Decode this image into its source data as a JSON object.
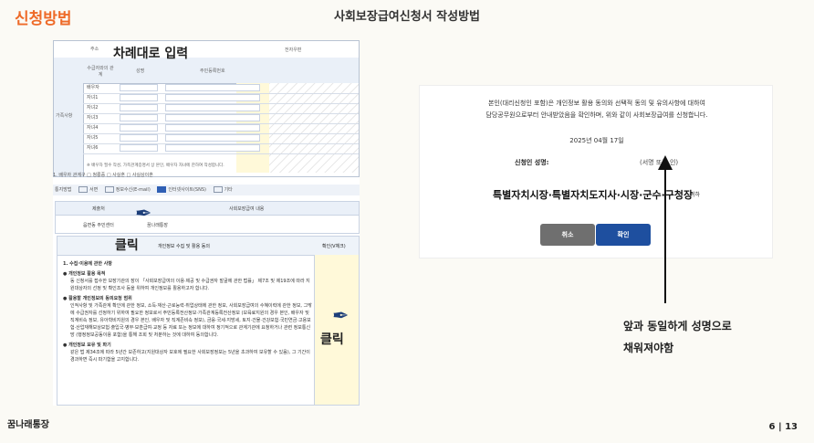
{
  "header": {
    "section_label": "신청방법",
    "page_title": "사회보장급여신청서 작성방법"
  },
  "footer": {
    "brand": "꿈나래통장",
    "page_number": "6 | 13"
  },
  "form_image": {
    "address_label": "주소",
    "phone_label": "전자우편",
    "annotation_order": "차례대로 입력",
    "annotation_click_1": "클릭",
    "annotation_click_2": "클릭",
    "family_section_label": "가족사항",
    "column_headers": [
      "수급자와의 관계",
      "성명",
      "주민등록번호"
    ],
    "family_rows": [
      "배우자",
      "자녀1",
      "자녀2",
      "자녀3",
      "자녀4",
      "자녀5",
      "자녀6"
    ],
    "family_note": "※ 배우자 필수 작성, 가족관계증명서 상 본인, 배우자 자녀에 한하여 작성합니다.",
    "disability_line": "1. 배우자 관계구 □ 청룡증  □ 사실혼  □ 사실상이혼",
    "receive_method_label": "통지방법",
    "receive_options": [
      {
        "label": "서면",
        "checked": false
      },
      {
        "label": "정보수신(E-mail)",
        "checked": false
      },
      {
        "label": "인터넷사이트(SNS)",
        "checked": true
      },
      {
        "label": "기타",
        "checked": false
      }
    ],
    "service_table": {
      "headers": [
        "제출처",
        "사회보장급여 내용"
      ],
      "row": [
        "읍면동 주민센터",
        "꿈나래통장"
      ]
    },
    "consent": {
      "header": "개인정보 수집 및 활용 동의",
      "confirm_column": "확인(V체크)",
      "section_title": "1. 수집·이용에 관한 사항",
      "items": [
        {
          "title": "● 개인정보 활용 목적",
          "text": "동 신청서를 접수한 보장기관의 장이 「사회보장급여의 이용·제공 및 수급권자 발굴에 관한 법률」 제7조 및 제19조에 따라 지원대상자의 선정 및 확인조사 등을 위하여 개인정보를 활용하고자 합니다."
        },
        {
          "title": "● 활용할 개인정보의 동의요청 범위",
          "text": "인적사항 및 가족관계 확인에 관한 정보, 소득·재산·근로능력·취업상태에 관한 정보, 사회보장급여의 수혜이력에 관한 정보, 그밖에 수급권자를 선정하기 위하여 필요한 정보로서 주민등록전산정보·가족관계등록전산정보 (보육료지원의 경우 본인, 배우자 및 직계비속 정보, 유아학비지원의 경우 본인, 배우자 및 직계존비속 정보), 금융·국세·지방세, 토지·건물·건강보험·국민연금·고용보험·산업재해보상보험·출입국·병무·보훈급여·교정 등 자료 또는 정보에 대하여 정기적으로 관계기관에 요청하거나 관련 정보통신망 (행정정보공동이용 포함)을 통해 조회 및 처분하는 것에 대하여 동의합니다."
        },
        {
          "title": "● 개인정보 보유 및 파기",
          "text": "같은 법 제34조에 따라 5년간 보존하고(지원대상자 보호에 필요한 사회보장정보는 5년을 초과하여 보유할 수 있음), 그 기간이 경과하면 즉시 파기함을 고지합니다."
        }
      ]
    }
  },
  "dialog": {
    "line1": "본인(대리신청인 포함)은 개인정보 활용 동의와 선택적 동의 및 유의사항에 대하여",
    "line2": "담당공무원으로부터 안내받았음을 확인하며, 위와 같이 사회보장급여를 신청합니다.",
    "date": "2025년 04월 17일",
    "sign_label": "신청인 성명:",
    "sign_hint": "(서명 또는 인)",
    "addressee": "특별자치시장·특별자치도지사·시장·군수·구청장",
    "addressee_suffix": "귀하",
    "cancel_label": "취소",
    "confirm_label": "확인"
  },
  "note": {
    "line1": "앞과 동일하게 성명으로",
    "line2": "채워져야함"
  },
  "colors": {
    "accent": "#ee6a28",
    "confirm_button": "#1e4f9f",
    "cancel_button": "#6f6f6f",
    "highlight": "#fff9d9"
  }
}
